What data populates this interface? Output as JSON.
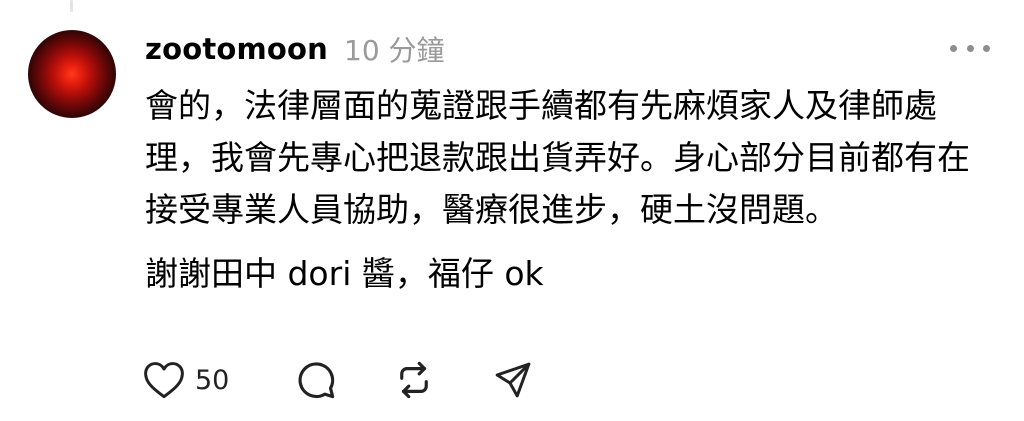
{
  "post": {
    "username": "zootomoon",
    "timestamp": "10 分鐘",
    "body_paragraph_1": "會的，法律層面的蒐證跟手續都有先麻煩家人及律師處理，我會先專心把退款跟出貨弄好。身心部分目前都有在接受專業人員協助，醫療很進步，硬土沒問題。",
    "body_paragraph_2": "謝謝田中 dori 醬，福仔 ok"
  },
  "actions": {
    "like_count": "50",
    "icons": [
      "heart-icon",
      "comment-icon",
      "repost-icon",
      "share-icon"
    ]
  },
  "colors": {
    "text": "#000000",
    "muted": "#9a9a9a",
    "icon": "#222222",
    "avatar_center": "#e8200f",
    "avatar_edge": "#0d0101"
  }
}
